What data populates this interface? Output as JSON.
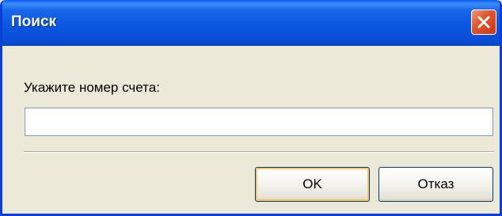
{
  "window": {
    "title": "Поиск"
  },
  "form": {
    "label": "Укажите номер счета:",
    "account_value": "",
    "account_placeholder": ""
  },
  "buttons": {
    "ok_label": "OK",
    "cancel_label": "Отказ"
  },
  "icons": {
    "close": "close-icon"
  },
  "colors": {
    "titlebar": "#0a56e0",
    "close_button": "#e2562c",
    "dialog_background": "#ece9d8",
    "input_border": "#7f9db9"
  }
}
